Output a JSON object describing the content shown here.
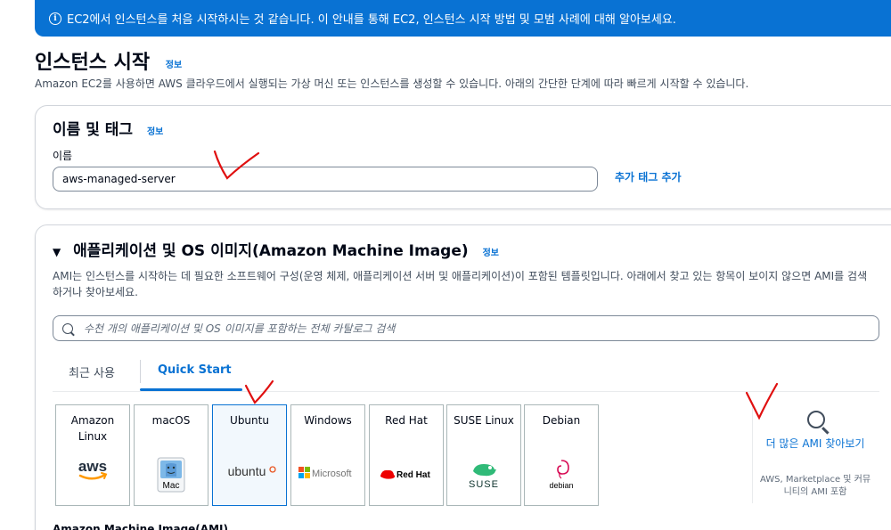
{
  "banner": {
    "text": "EC2에서 인스턴스를 처음 시작하시는 것 같습니다. 이 안내를 통해 EC2, 인스턴스 시작 방법 및 모범 사례에 대해 알아보세요.",
    "icon": "info-icon"
  },
  "page": {
    "title": "인스턴스 시작",
    "info": "정보",
    "description": "Amazon EC2를 사용하면 AWS 클라우드에서 실행되는 가상 머신 또는 인스턴스를 생성할 수 있습니다. 아래의 간단한 단계에 따라 빠르게 시작할 수 있습니다."
  },
  "name_tags": {
    "title": "이름 및 태그",
    "info": "정보",
    "label": "이름",
    "value": "aws-managed-server",
    "add_tag": "추가 태그 추가"
  },
  "ami": {
    "title": "애플리케이션 및 OS 이미지(Amazon Machine Image)",
    "info": "정보",
    "description": "AMI는 인스턴스를 시작하는 데 필요한 소프트웨어 구성(운영 체제, 애플리케이션 서버 및 애플리케이션)이 포함된 템플릿입니다. 아래에서 찾고 있는 항목이 보이지 않으면 AMI를 검색하거나 찾아보세요.",
    "search_placeholder": "수천 개의 애플리케이션 및 OS 이미지를 포함하는 전체 카탈로그 검색",
    "tabs": [
      "최근 사용",
      "Quick Start"
    ],
    "active_tab": "Quick Start",
    "os_options": [
      {
        "name": "Amazon Linux",
        "logo": "aws"
      },
      {
        "name": "macOS",
        "logo": "Mac"
      },
      {
        "name": "Ubuntu",
        "logo": "ubuntu"
      },
      {
        "name": "Windows",
        "logo": "Microsoft"
      },
      {
        "name": "Red Hat",
        "logo": "Red Hat"
      },
      {
        "name": "SUSE Linux",
        "logo": "SUSE"
      },
      {
        "name": "Debian",
        "logo": "debian"
      }
    ],
    "selected_os": "Ubuntu",
    "browse_more": "더 많은 AMI 찾아보기",
    "browse_sub": "AWS, Marketplace 및 커뮤니티의 AMI 포함",
    "ami_label": "Amazon Machine Image(AMI)"
  },
  "colors": {
    "accent": "#0972d3",
    "annotation": "#e01010"
  }
}
